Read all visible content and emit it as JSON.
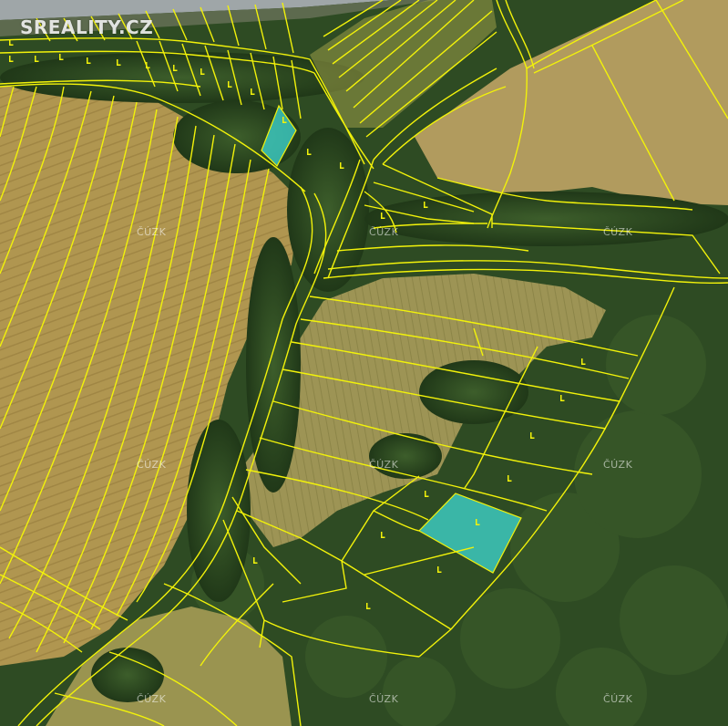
{
  "logo": {
    "text": "SREALITY.CZ"
  },
  "watermarks": [
    "ČÚZK",
    "ČÚZK",
    "ČÚZK",
    "ČÚZK",
    "ČÚZK",
    "ČÚZK",
    "ČÚZK",
    "ČÚZK",
    "ČÚZK"
  ],
  "colors": {
    "parcel_line": "#f2f20a",
    "highlight_fill": "#3fd9d4",
    "field": "#b39a52",
    "meadow": "#8f9150",
    "forest": "#2d4a22",
    "road": "#aab0b3"
  },
  "symbols": {
    "forest_marker": "forest-parcel-symbol"
  }
}
